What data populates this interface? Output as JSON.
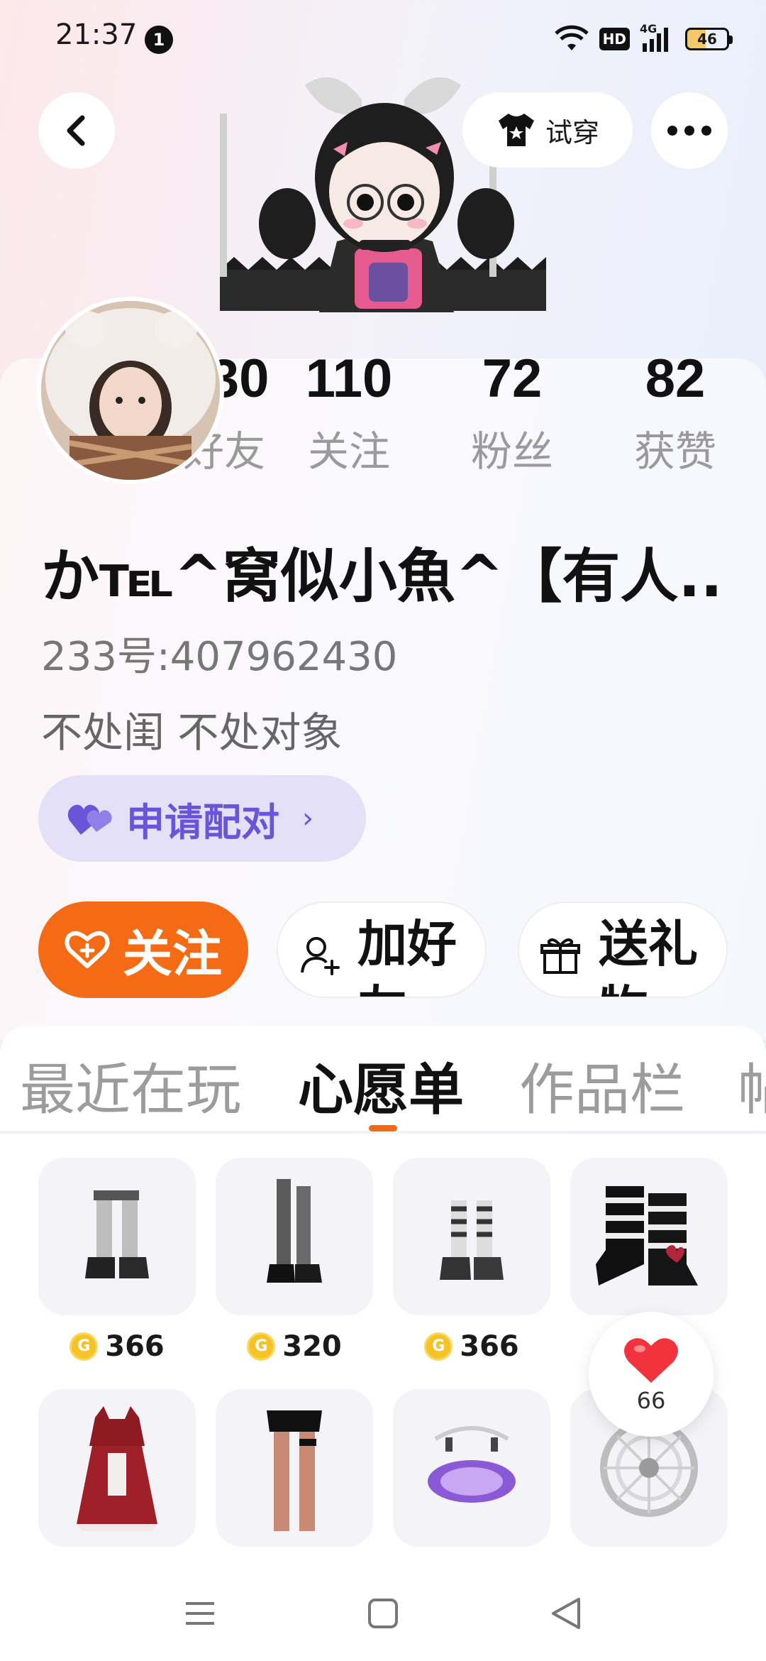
{
  "status_bar": {
    "time": "21:37",
    "notification_count": "1",
    "hd_label": "HD",
    "network_label": "4G",
    "battery": "46"
  },
  "header": {
    "try_on_label": "试穿"
  },
  "stats": [
    {
      "value": "530",
      "label": "好友"
    },
    {
      "value": "110",
      "label": "关注"
    },
    {
      "value": "72",
      "label": "粉丝"
    },
    {
      "value": "82",
      "label": "获赞"
    }
  ],
  "profile": {
    "nickname": "か℡^窝似小魚^【有人...",
    "user_id": "233号:407962430",
    "bio": "不处闺 不处对象",
    "match_label": "申请配对"
  },
  "actions": {
    "follow_label": "关注",
    "add_friend_label": "加好友",
    "send_gift_label": "送礼物"
  },
  "tabs": [
    "最近在玩",
    "心愿单",
    "作品栏",
    "帖"
  ],
  "items": [
    {
      "price": "366"
    },
    {
      "price": "320"
    },
    {
      "price": "366"
    },
    {
      "price": ""
    },
    {
      "price": ""
    },
    {
      "price": ""
    },
    {
      "price": ""
    },
    {
      "price": ""
    }
  ],
  "coin_symbol": "G",
  "likes": {
    "count": "66"
  },
  "colors": {
    "accent": "#f56a14",
    "match": "#6a55d8",
    "like": "#f2323c"
  }
}
